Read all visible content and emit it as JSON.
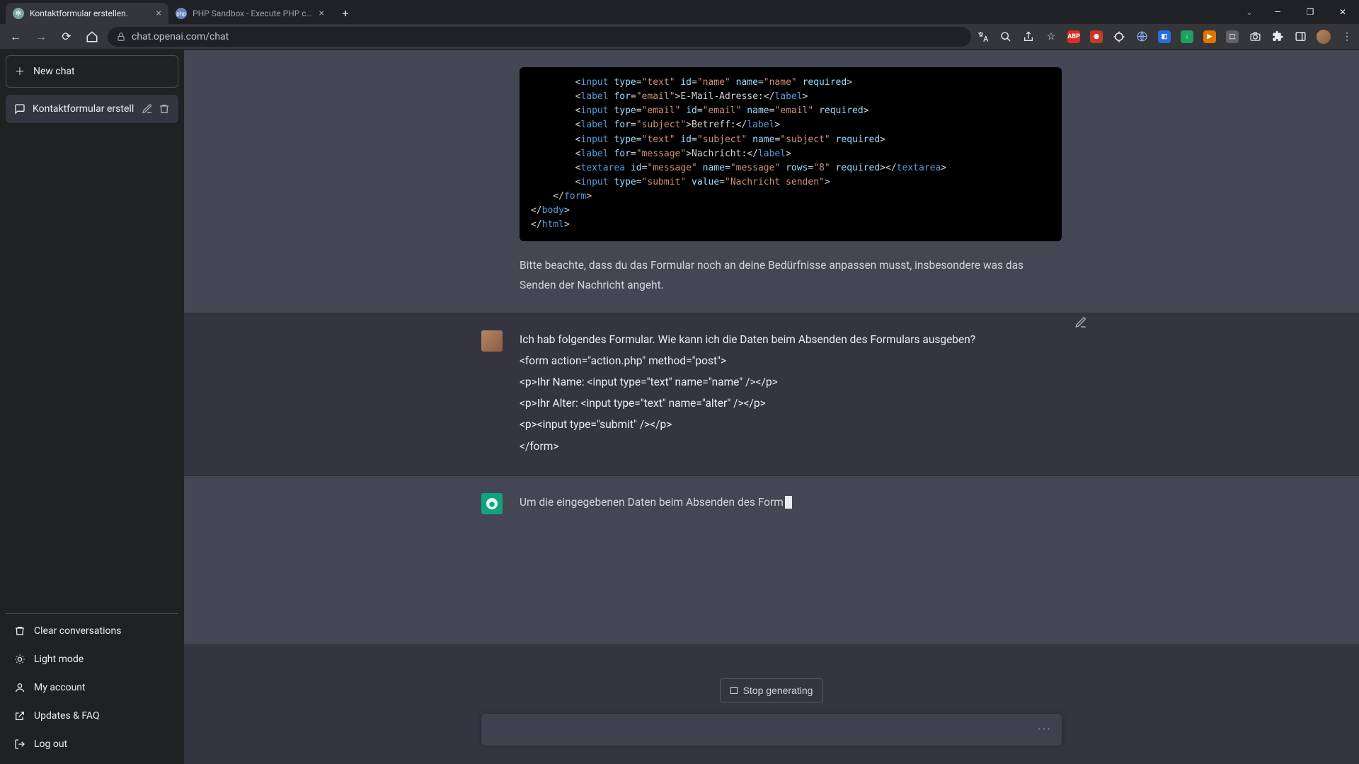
{
  "browser": {
    "tabs": [
      {
        "title": "Kontaktformular erstellen.",
        "active": true,
        "favicon": "openai"
      },
      {
        "title": "PHP Sandbox - Execute PHP cod",
        "active": false,
        "favicon": "php"
      }
    ],
    "url_display": "chat.openai.com/chat"
  },
  "sidebar": {
    "new_chat_label": "New chat",
    "active_chat_title": "Kontaktformular erstell",
    "footer": {
      "clear": "Clear conversations",
      "light_mode": "Light mode",
      "account": "My account",
      "updates": "Updates & FAQ",
      "logout": "Log out"
    }
  },
  "messages": {
    "assistant1_note": "Bitte beachte, dass du das Formular noch an deine Bedürfnisse anpassen musst, insbesondere was das Senden der Nachricht angeht.",
    "user1_intro": "Ich hab folgendes Formular. Wie kann ich die Daten beim Absenden des Formulars ausgeben?",
    "user1_code_line1": "<form action=\"action.php\" method=\"post\">",
    "user1_code_line2": " <p>Ihr Name: <input type=\"text\" name=\"name\" /></p>",
    "user1_code_line3": " <p>Ihr Alter: <input type=\"text\" name=\"alter\" /></p>",
    "user1_code_line4": " <p><input type=\"submit\" /></p>",
    "user1_code_line5": "</form>",
    "assistant2_text": "Um die eingegebenen Daten beim Absenden des Form"
  },
  "code": {
    "l1_text_email": "E-Mail-Adresse:",
    "l2_text_betreff": "Betreff:",
    "l3_text_nachricht": "Nachricht:",
    "submit_value": "Nachricht senden"
  },
  "controls": {
    "stop_label": "Stop generating"
  }
}
